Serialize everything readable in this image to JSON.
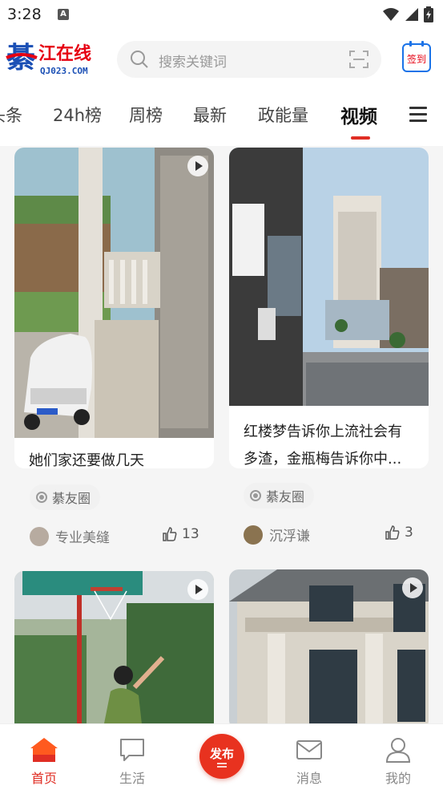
{
  "status_bar": {
    "time": "3:28",
    "sim_label": "A"
  },
  "header": {
    "logo_text": "綦江在线",
    "logo_url_text": "QJ023.COM",
    "search_placeholder": "搜索关键词",
    "signin_label": "签到"
  },
  "tabs": [
    {
      "label": "头条",
      "active": false
    },
    {
      "label": "24h榜",
      "active": false
    },
    {
      "label": "周榜",
      "active": false
    },
    {
      "label": "最新",
      "active": false
    },
    {
      "label": "政能量",
      "active": false
    },
    {
      "label": "视频",
      "active": true
    }
  ],
  "cards": [
    {
      "title": "她们家还要做几天",
      "tag": "綦友圈",
      "author": "专业美缝",
      "likes": "13"
    },
    {
      "title": "红楼梦告诉你上流社会有多渣，金瓶梅告诉你中...",
      "tag": "綦友圈",
      "author": "沉浮谦",
      "likes": "3"
    },
    {
      "title": "",
      "tag": "",
      "author": "",
      "likes": ""
    },
    {
      "title": "",
      "tag": "",
      "author": "",
      "likes": ""
    }
  ],
  "bottom_nav": [
    {
      "label": "首页",
      "icon": "home-icon",
      "active": true
    },
    {
      "label": "生活",
      "icon": "chat-bubble-icon",
      "active": false
    },
    {
      "label": "发布",
      "icon": "publish-icon",
      "active": false
    },
    {
      "label": "消息",
      "icon": "mail-icon",
      "active": false
    },
    {
      "label": "我的",
      "icon": "user-icon",
      "active": false
    }
  ],
  "colors": {
    "accent": "#e02e24",
    "brand_blue": "#1a4fb5",
    "brand_red": "#e60012"
  }
}
